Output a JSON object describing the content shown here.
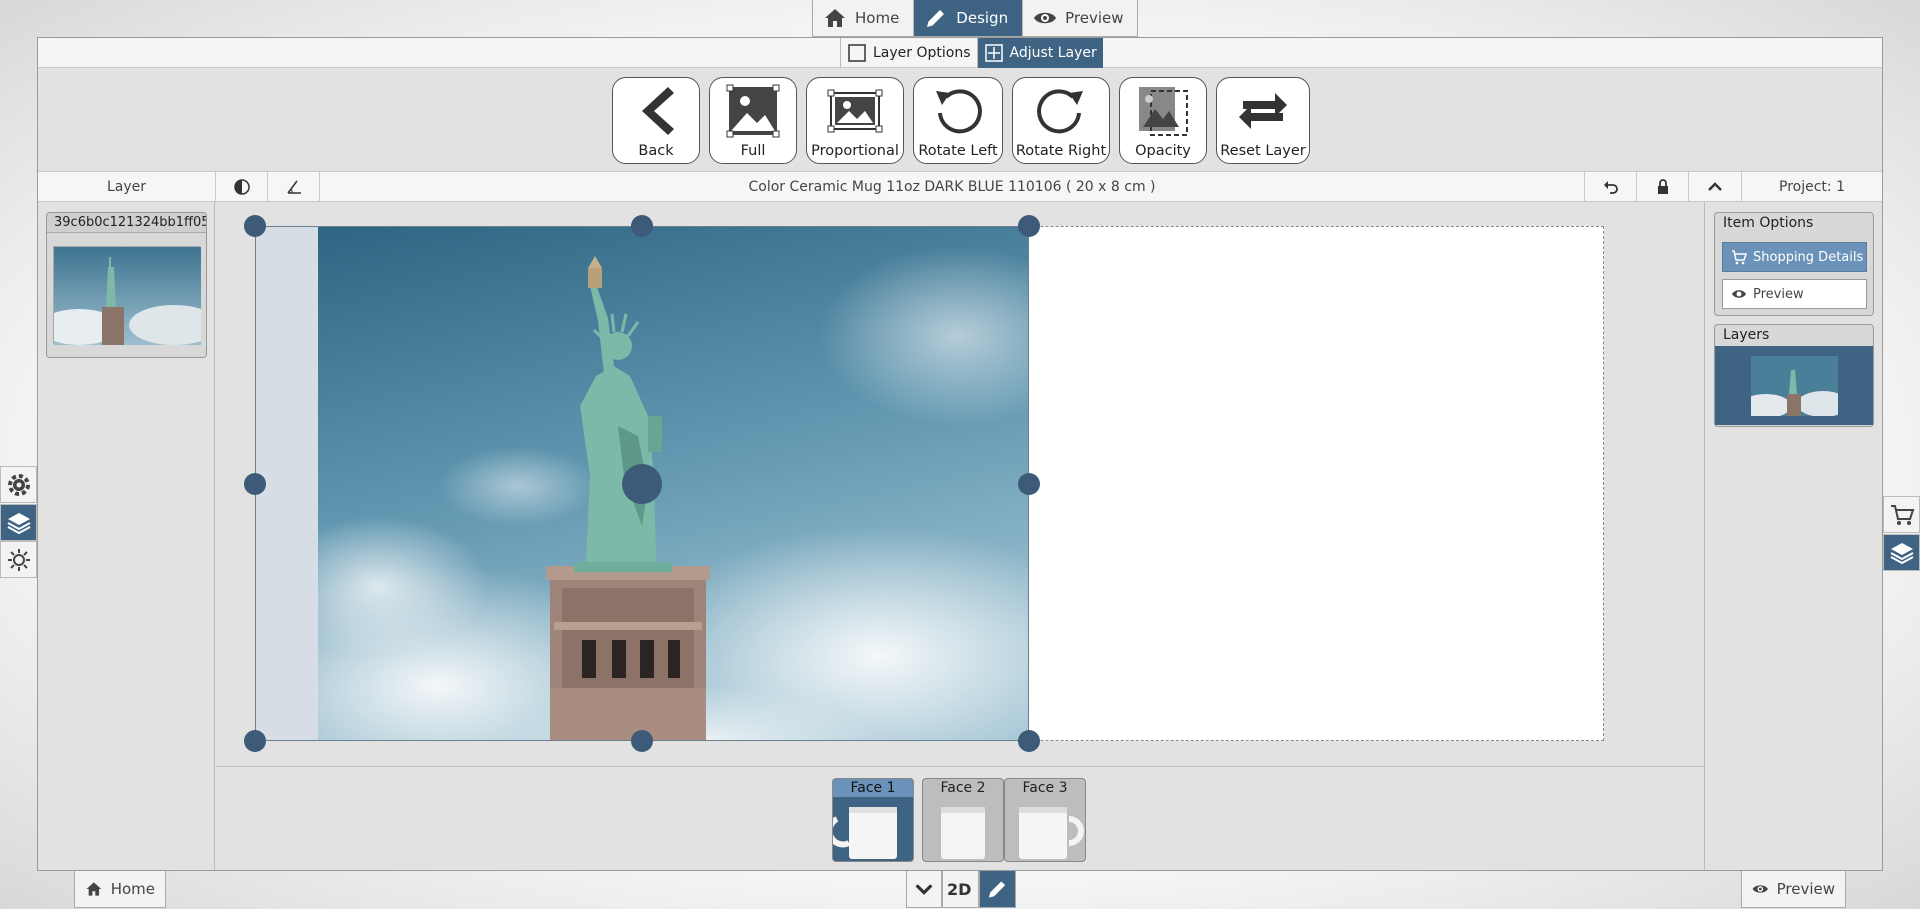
{
  "top_tabs": {
    "home": "Home",
    "design": "Design",
    "preview": "Preview"
  },
  "sub_tabs": {
    "layer_options": "Layer Options",
    "adjust_layer": "Adjust Layer"
  },
  "toolbar": {
    "back": "Back",
    "full": "Full",
    "proportional": "Proportional",
    "rotate_left": "Rotate Left",
    "rotate_right": "Rotate Right",
    "opacity": "Opacity",
    "reset_layer": "Reset Layer"
  },
  "infobar": {
    "layer_label": "Layer",
    "product_title": "Color Ceramic Mug 11oz DARK BLUE 110106 ( 20 x 8 cm )",
    "project_label": "Project: 1"
  },
  "left_panel": {
    "layer_name": "39c6b0c121324bb1ff05..."
  },
  "right_panel": {
    "item_options_title": "Item Options",
    "shopping_details": "Shopping Details",
    "preview": "Preview",
    "layers_title": "Layers"
  },
  "faces": [
    {
      "label": "Face 1"
    },
    {
      "label": "Face 2"
    },
    {
      "label": "Face 3"
    }
  ],
  "bottom_bar": {
    "home": "Home",
    "view_mode": "2D",
    "preview": "Preview"
  },
  "colors": {
    "accent": "#3e6383",
    "accent_light": "#6b93b9",
    "handle": "#3d5b78"
  }
}
